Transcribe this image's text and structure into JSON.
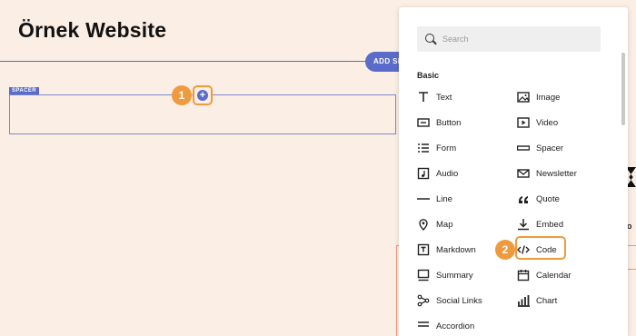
{
  "site": {
    "title": "Örnek Website"
  },
  "toolbar": {
    "add_section_label": "ADD SECTION"
  },
  "spacer": {
    "tag": "SPACER"
  },
  "steps": {
    "one": "1",
    "two": "2"
  },
  "plus": {
    "glyph": "+"
  },
  "picker": {
    "search_placeholder": "Search",
    "group_title": "Basic",
    "blocks": [
      {
        "label": "Text",
        "icon": "text-icon"
      },
      {
        "label": "Image",
        "icon": "image-icon"
      },
      {
        "label": "Button",
        "icon": "button-icon"
      },
      {
        "label": "Video",
        "icon": "video-icon"
      },
      {
        "label": "Form",
        "icon": "form-icon"
      },
      {
        "label": "Spacer",
        "icon": "spacer-icon"
      },
      {
        "label": "Audio",
        "icon": "audio-icon"
      },
      {
        "label": "Newsletter",
        "icon": "newsletter-icon"
      },
      {
        "label": "Line",
        "icon": "line-icon"
      },
      {
        "label": "Quote",
        "icon": "quote-icon"
      },
      {
        "label": "Map",
        "icon": "map-pin-icon"
      },
      {
        "label": "Embed",
        "icon": "embed-icon"
      },
      {
        "label": "Markdown",
        "icon": "markdown-icon"
      },
      {
        "label": "Code",
        "icon": "code-icon"
      },
      {
        "label": "Summary",
        "icon": "summary-icon"
      },
      {
        "label": "Calendar",
        "icon": "calendar-icon"
      },
      {
        "label": "Social Links",
        "icon": "social-links-icon"
      },
      {
        "label": "Chart",
        "icon": "chart-icon"
      },
      {
        "label": "Accordion",
        "icon": "accordion-icon"
      }
    ]
  },
  "colors": {
    "accent": "#5b6bc9",
    "highlight": "#ef9a3d",
    "background": "#fbeee4"
  }
}
